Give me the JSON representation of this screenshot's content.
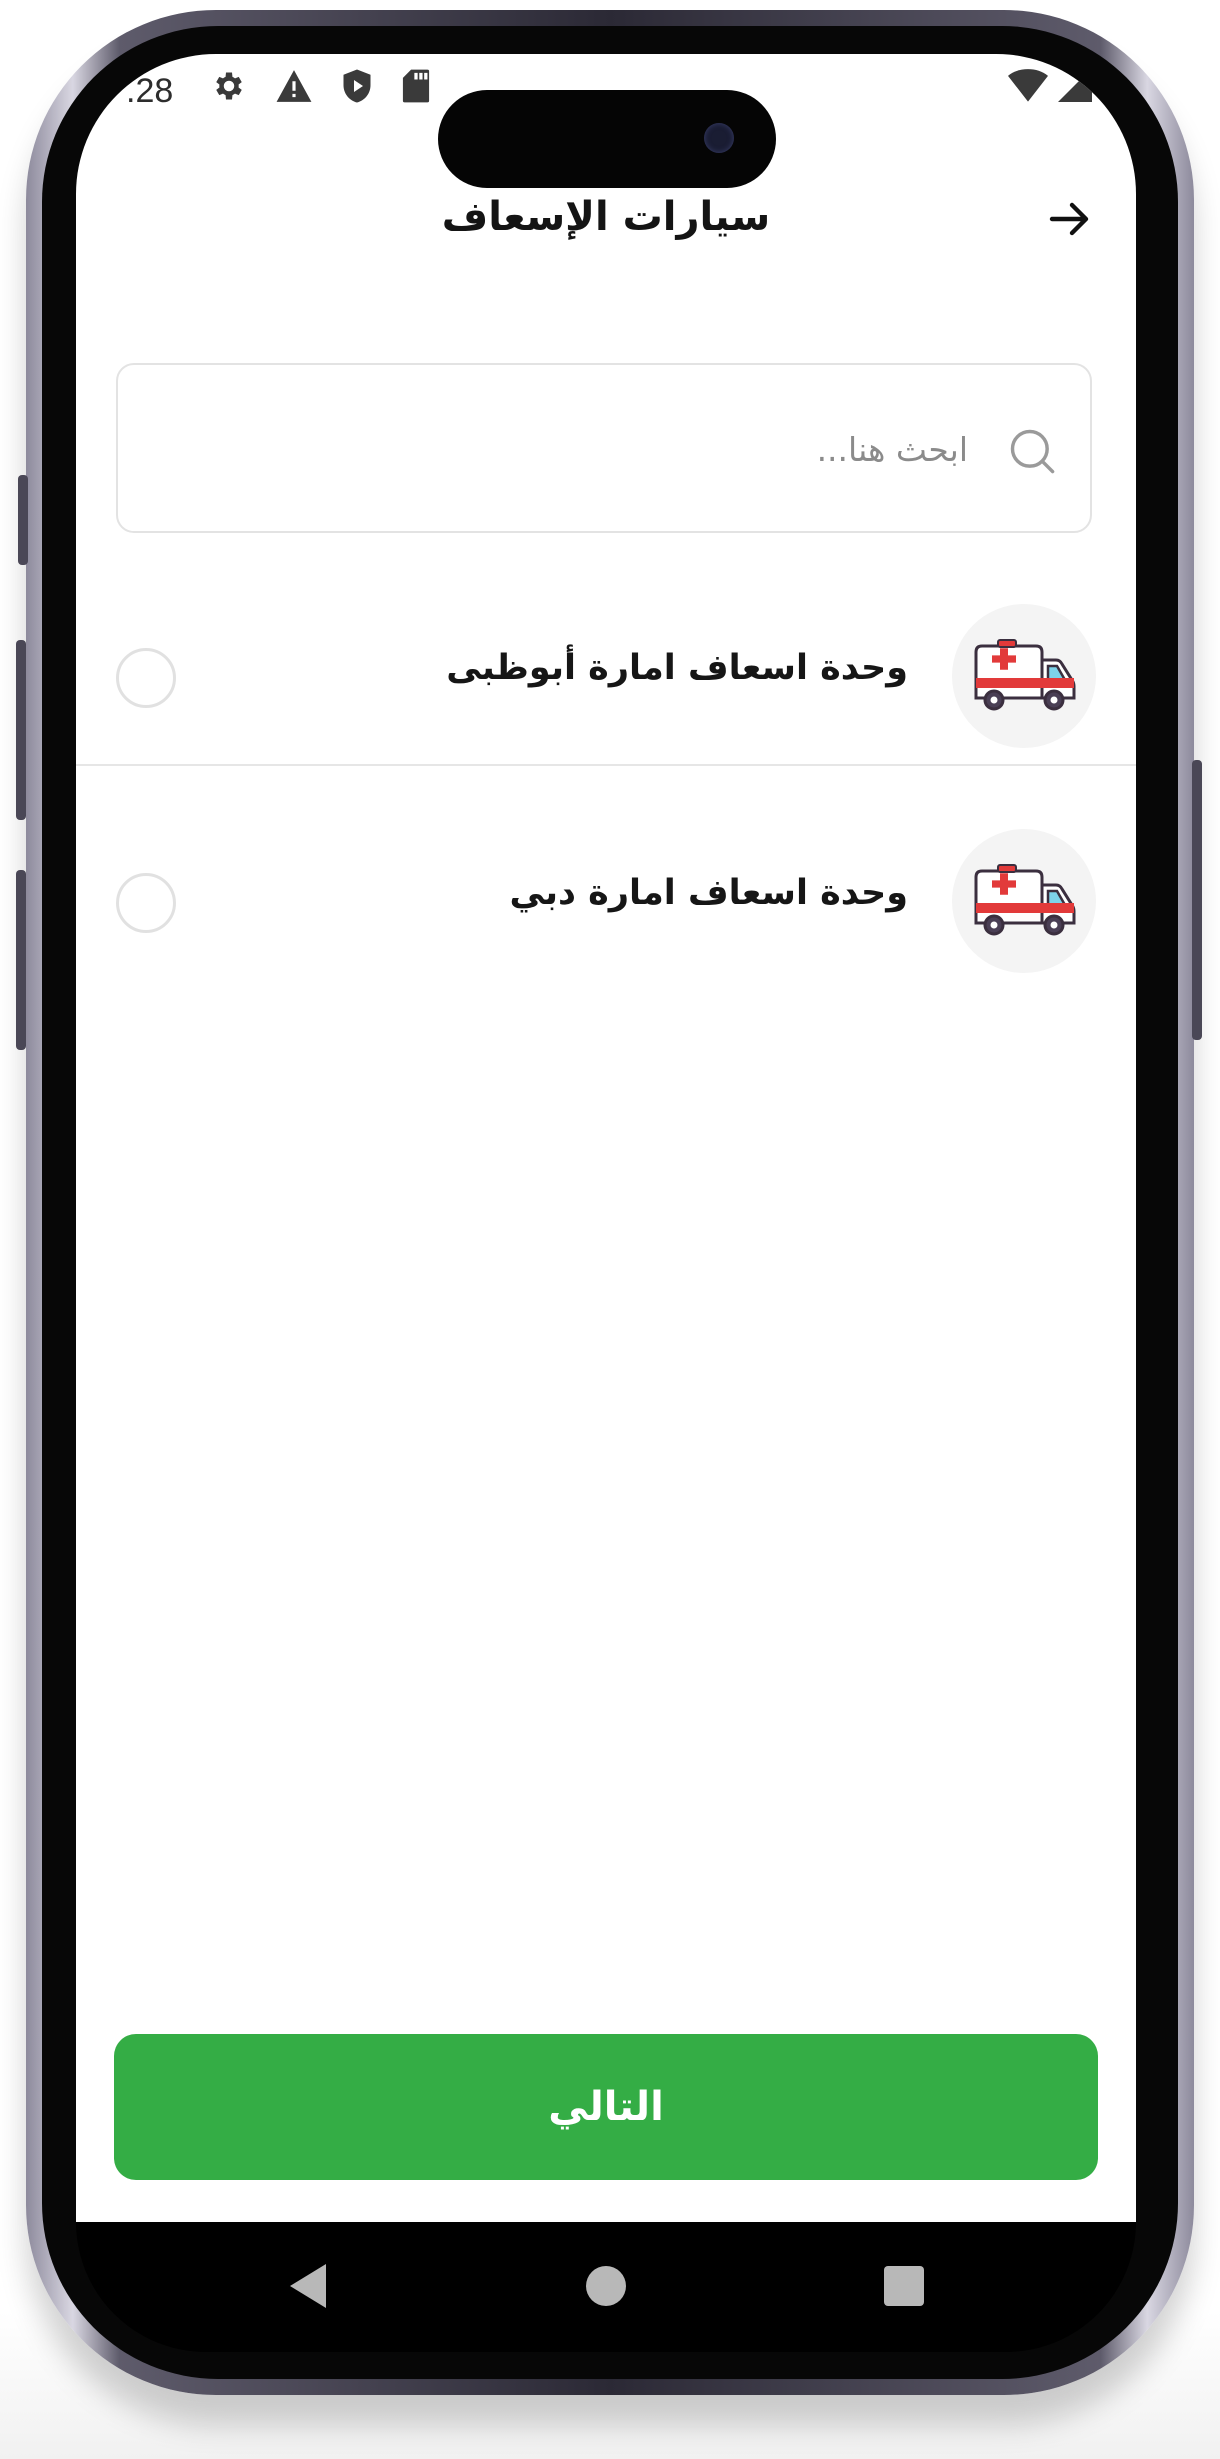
{
  "status_bar": {
    "time": ".28"
  },
  "header": {
    "title": "سيارات الإسعاف"
  },
  "search": {
    "placeholder": "ابحث هنا..."
  },
  "items": [
    {
      "label": "وحدة اسعاف امارة أبوظبى",
      "icon": "ambulance-icon",
      "selected": false
    },
    {
      "label": "وحدة اسعاف امارة دبي",
      "icon": "ambulance-icon",
      "selected": false
    }
  ],
  "footer": {
    "next_label": "التالي"
  },
  "colors": {
    "primary": "#34ad45",
    "divider": "#e6e6e6",
    "avatar_bg": "#f4f4f4"
  }
}
